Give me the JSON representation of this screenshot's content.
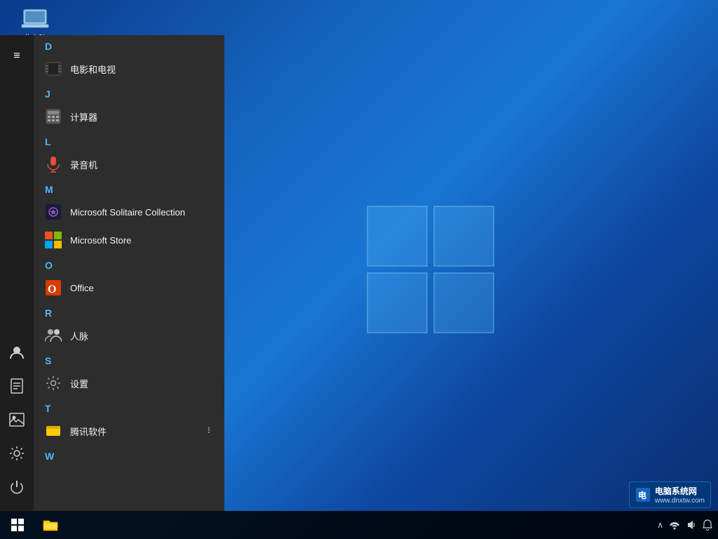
{
  "desktop": {
    "background_desc": "Windows 10 blue gradient background",
    "icon": {
      "label": "此电脑",
      "name": "this-pc-icon"
    }
  },
  "start_menu": {
    "sections": [
      {
        "letter": "D",
        "apps": [
          {
            "id": "movies",
            "label": "电影和电视",
            "icon_type": "movie"
          }
        ]
      },
      {
        "letter": "J",
        "apps": [
          {
            "id": "calculator",
            "label": "计算器",
            "icon_type": "calc"
          }
        ]
      },
      {
        "letter": "L",
        "apps": [
          {
            "id": "recorder",
            "label": "录音机",
            "icon_type": "mic"
          }
        ]
      },
      {
        "letter": "M",
        "apps": [
          {
            "id": "solitaire",
            "label": "Microsoft Solitaire Collection",
            "icon_type": "solitaire"
          },
          {
            "id": "store",
            "label": "Microsoft Store",
            "icon_type": "store"
          }
        ]
      },
      {
        "letter": "O",
        "apps": [
          {
            "id": "office",
            "label": "Office",
            "icon_type": "office"
          }
        ]
      },
      {
        "letter": "R",
        "apps": [
          {
            "id": "people",
            "label": "人脉",
            "icon_type": "people"
          }
        ]
      },
      {
        "letter": "S",
        "apps": [
          {
            "id": "settings",
            "label": "设置",
            "icon_type": "settings"
          }
        ]
      },
      {
        "letter": "T",
        "apps": [
          {
            "id": "tencent",
            "label": "腾讯软件",
            "icon_type": "tencent",
            "expandable": true
          }
        ]
      },
      {
        "letter": "W",
        "apps": []
      }
    ],
    "sidebar_icons": [
      {
        "id": "hamburger",
        "symbol": "≡",
        "name": "hamburger-menu"
      },
      {
        "id": "user",
        "symbol": "👤",
        "name": "user-icon"
      },
      {
        "id": "docs",
        "symbol": "📄",
        "name": "documents-icon"
      },
      {
        "id": "photos",
        "symbol": "🖼",
        "name": "photos-icon"
      },
      {
        "id": "settings",
        "symbol": "⚙",
        "name": "settings-icon"
      },
      {
        "id": "power",
        "symbol": "⏻",
        "name": "power-icon"
      }
    ]
  },
  "taskbar": {
    "start_label": "Start",
    "tray": {
      "chevron": "∧",
      "battery": "🔋",
      "network": "🌐",
      "sound": "🔊",
      "time": "...",
      "notification": "🔔"
    }
  },
  "watermark": {
    "text": "电脑系统网",
    "subtext": "www.dnxtw.com"
  }
}
